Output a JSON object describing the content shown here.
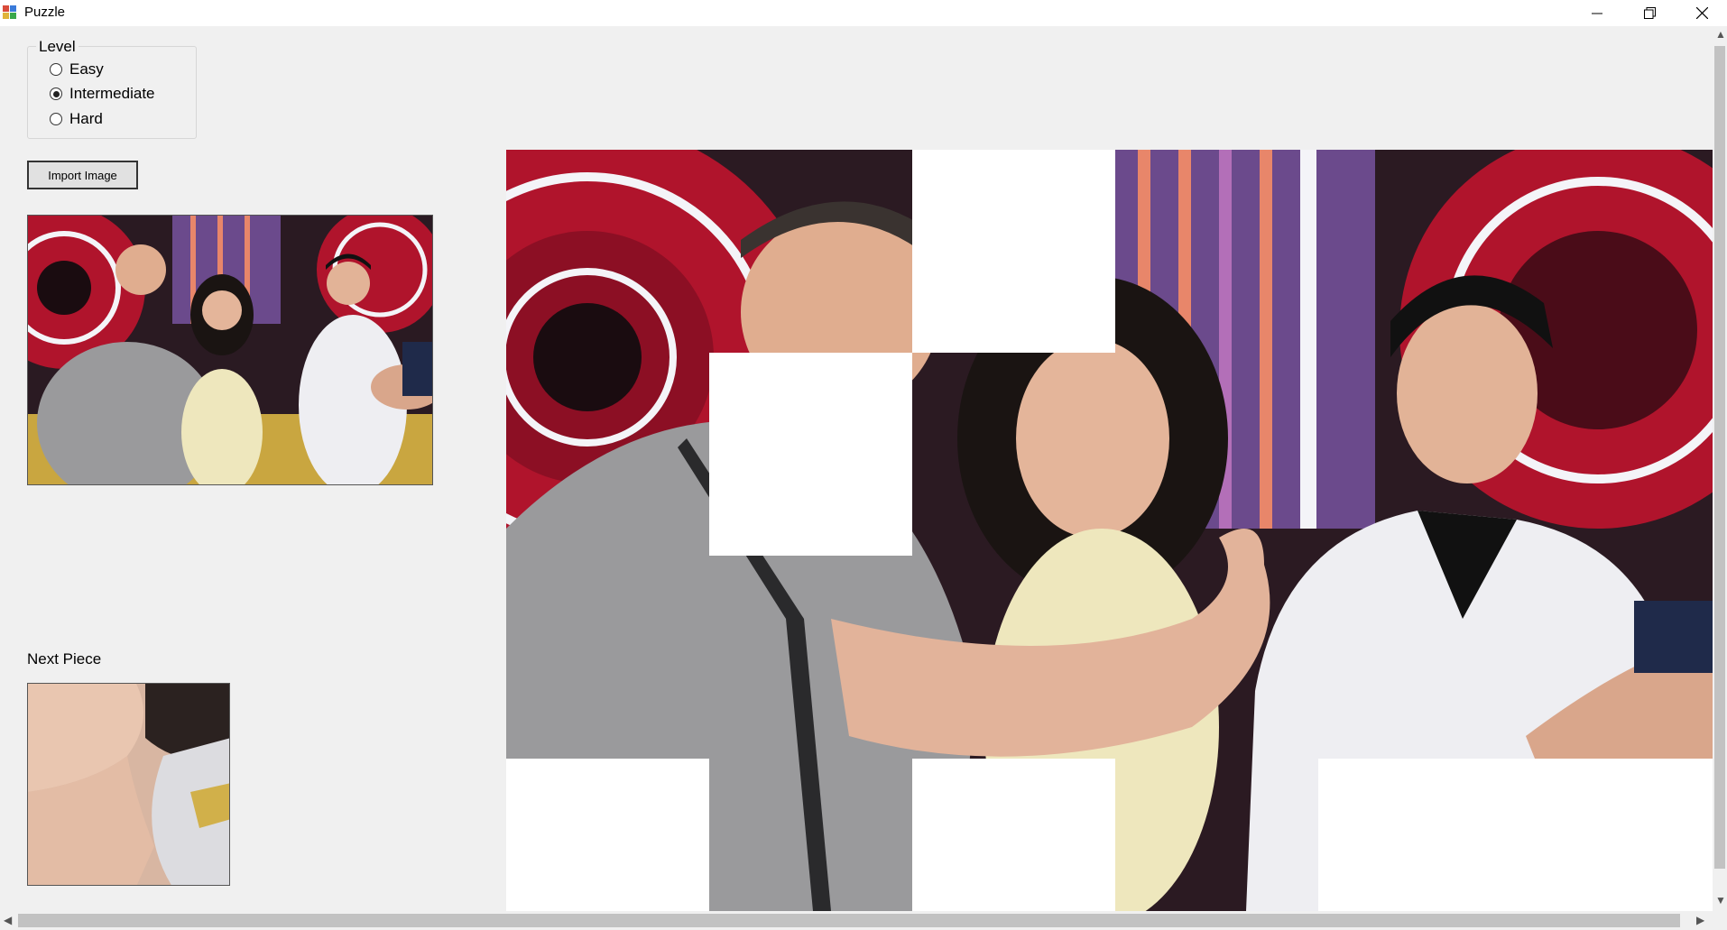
{
  "window": {
    "title": "Puzzle",
    "icons": {
      "app": "puzzle-app-icon",
      "minimize": "minimize-icon",
      "maximize": "restore-icon",
      "close": "close-icon"
    }
  },
  "level": {
    "label": "Level",
    "options": [
      {
        "label": "Easy",
        "checked": false
      },
      {
        "label": "Intermediate",
        "checked": true
      },
      {
        "label": "Hard",
        "checked": false
      }
    ]
  },
  "import_button": {
    "label": "Import Image"
  },
  "next_piece": {
    "label": "Next Piece"
  },
  "colors": {
    "background": "#f0f0f0",
    "stage_red": "#b0142c",
    "stage_purple": "#6b4a8c",
    "shirt_grey": "#9a9a9c",
    "white_shirt": "#eeeef2",
    "dress_cream": "#eee7bd",
    "skin": "#e4b59a"
  }
}
